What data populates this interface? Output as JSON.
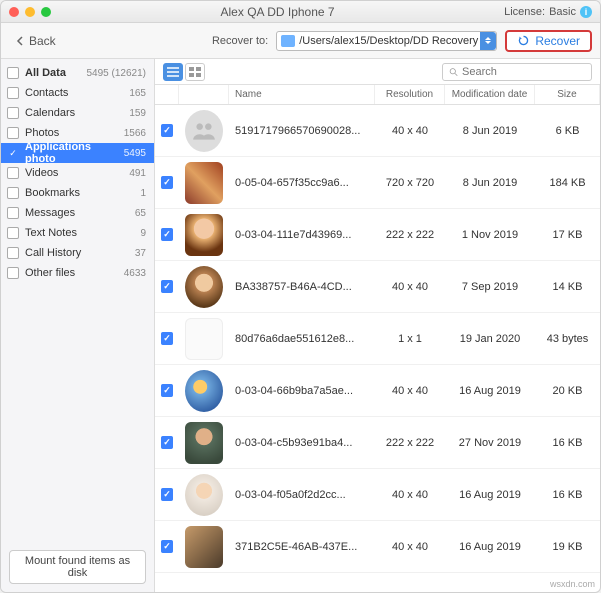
{
  "titlebar": {
    "title": "Alex QA DD Iphone 7",
    "license_label": "License:",
    "license_value": "Basic"
  },
  "toolbar": {
    "back": "Back",
    "recover_to_label": "Recover to:",
    "path": "/Users/alex15/Desktop/DD Recovery",
    "recover_button": "Recover"
  },
  "sidebar": {
    "items": [
      {
        "label": "All Data",
        "count": "5495 (12621)",
        "checked": false,
        "bold": true
      },
      {
        "label": "Contacts",
        "count": "165",
        "checked": false,
        "bold": false
      },
      {
        "label": "Calendars",
        "count": "159",
        "checked": false,
        "bold": false
      },
      {
        "label": "Photos",
        "count": "1566",
        "checked": false,
        "bold": false
      },
      {
        "label": "Applications photo",
        "count": "5495",
        "checked": true,
        "bold": true,
        "selected": true
      },
      {
        "label": "Videos",
        "count": "491",
        "checked": false,
        "bold": false
      },
      {
        "label": "Bookmarks",
        "count": "1",
        "checked": false,
        "bold": false
      },
      {
        "label": "Messages",
        "count": "65",
        "checked": false,
        "bold": false
      },
      {
        "label": "Text Notes",
        "count": "9",
        "checked": false,
        "bold": false
      },
      {
        "label": "Call History",
        "count": "37",
        "checked": false,
        "bold": false
      },
      {
        "label": "Other files",
        "count": "4633",
        "checked": false,
        "bold": false
      }
    ],
    "mount_button": "Mount found items as disk"
  },
  "table": {
    "search_placeholder": "Search",
    "columns": {
      "name": "Name",
      "resolution": "Resolution",
      "date": "Modification date",
      "size": "Size"
    },
    "rows": [
      {
        "thumb": "placeholder",
        "shape": "circle",
        "name": "5191717966570690028...",
        "res": "40 x 40",
        "date": "8 Jun 2019",
        "size": "6 KB"
      },
      {
        "thumb": "food",
        "shape": "square",
        "name": "0-05-04-657f35cc9a6...",
        "res": "720 x 720",
        "date": "8 Jun 2019",
        "size": "184 KB"
      },
      {
        "thumb": "woman1",
        "shape": "square",
        "name": "0-03-04-111e7d43969...",
        "res": "222 x 222",
        "date": "1 Nov 2019",
        "size": "17 KB"
      },
      {
        "thumb": "woman2",
        "shape": "circle",
        "name": "BA338757-B46A-4CD...",
        "res": "40 x 40",
        "date": "7 Sep 2019",
        "size": "14 KB"
      },
      {
        "thumb": "blank",
        "shape": "square",
        "name": "80d76a6dae551612e8...",
        "res": "1 x 1",
        "date": "19 Jan 2020",
        "size": "43 bytes"
      },
      {
        "thumb": "family",
        "shape": "circle",
        "name": "0-03-04-66b9ba7a5ae...",
        "res": "40 x 40",
        "date": "16 Aug 2019",
        "size": "20 KB"
      },
      {
        "thumb": "man",
        "shape": "square",
        "name": "0-03-04-c5b93e91ba4...",
        "res": "222 x 222",
        "date": "27 Nov 2019",
        "size": "16 KB"
      },
      {
        "thumb": "woman3",
        "shape": "circle",
        "name": "0-03-04-f05a0f2d2cc...",
        "res": "40 x 40",
        "date": "16 Aug 2019",
        "size": "16 KB"
      },
      {
        "thumb": "couple",
        "shape": "square",
        "name": "371B2C5E-46AB-437E...",
        "res": "40 x 40",
        "date": "16 Aug 2019",
        "size": "19 KB"
      }
    ]
  },
  "watermark": "wsxdn.com"
}
